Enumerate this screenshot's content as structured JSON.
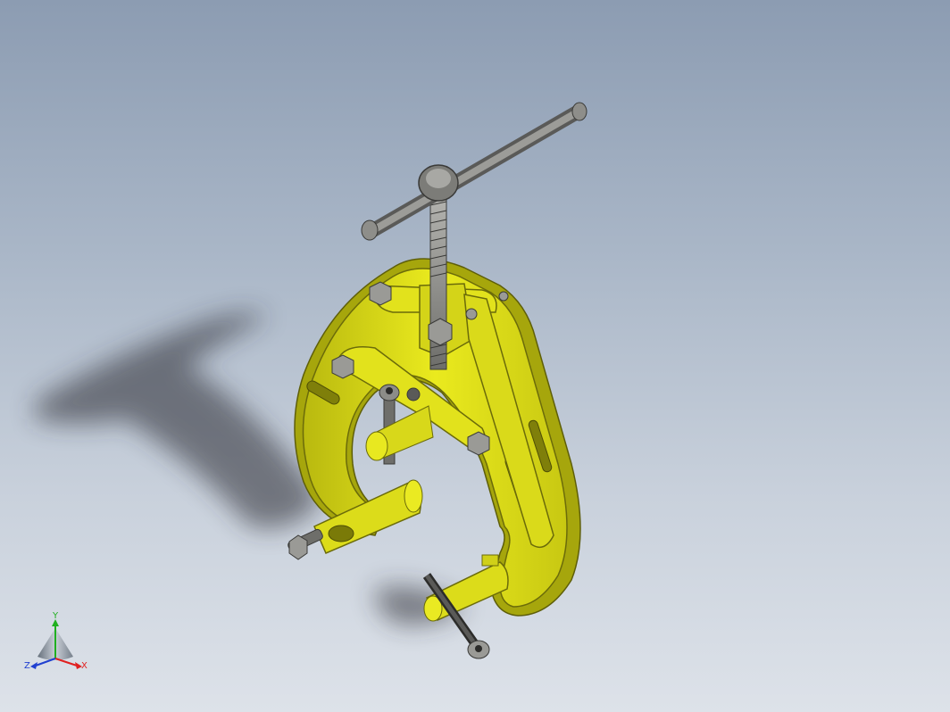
{
  "viewport": {
    "background_top": "#8c9cb2",
    "background_bottom": "#dde2e9"
  },
  "model": {
    "body_color": "#e6e619",
    "body_shade": "#a8a80c",
    "metal_color": "#8a8a86",
    "metal_dark": "#4a4a48"
  },
  "triad": {
    "x_label": "X",
    "y_label": "Y",
    "z_label": "Z",
    "x_color": "#e02020",
    "y_color": "#20b020",
    "z_color": "#2040d0"
  }
}
